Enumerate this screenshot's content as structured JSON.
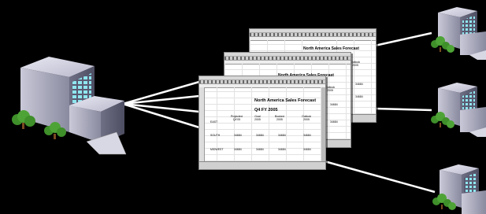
{
  "diagram": {
    "sheet": {
      "title": "North America Sales Forecast",
      "subtitle": "Q4 FY 2005",
      "columns": [
        {
          "label": "Projected\nQ4'05"
        },
        {
          "label": "Goal\n2005"
        },
        {
          "label": "Booked\n2005"
        },
        {
          "label": "Outlook\n2005"
        }
      ],
      "rows": [
        {
          "label": "EAST",
          "values": [
            "",
            "",
            "",
            ""
          ]
        },
        {
          "label": "SOUTH",
          "values": [
            "34684",
            "34684",
            "34684",
            "34684"
          ]
        },
        {
          "label": "MIDWEST",
          "values": [
            "34684",
            "34684",
            "34684",
            "34684"
          ]
        }
      ],
      "back_values": [
        "34684",
        "34684",
        "34684"
      ],
      "back_col_label": "Outlook\n2005"
    },
    "colors": {
      "background": "#000000",
      "connector": "#ffffff",
      "building_face": "#8a8aa0",
      "building_windows": "#8fe6ee",
      "tree": "#3f8f2a"
    },
    "icons": {
      "headquarters": "office-building-icon",
      "branch": "branch-office-icon",
      "document": "spreadsheet-document-icon",
      "tree": "tree-icon"
    }
  }
}
